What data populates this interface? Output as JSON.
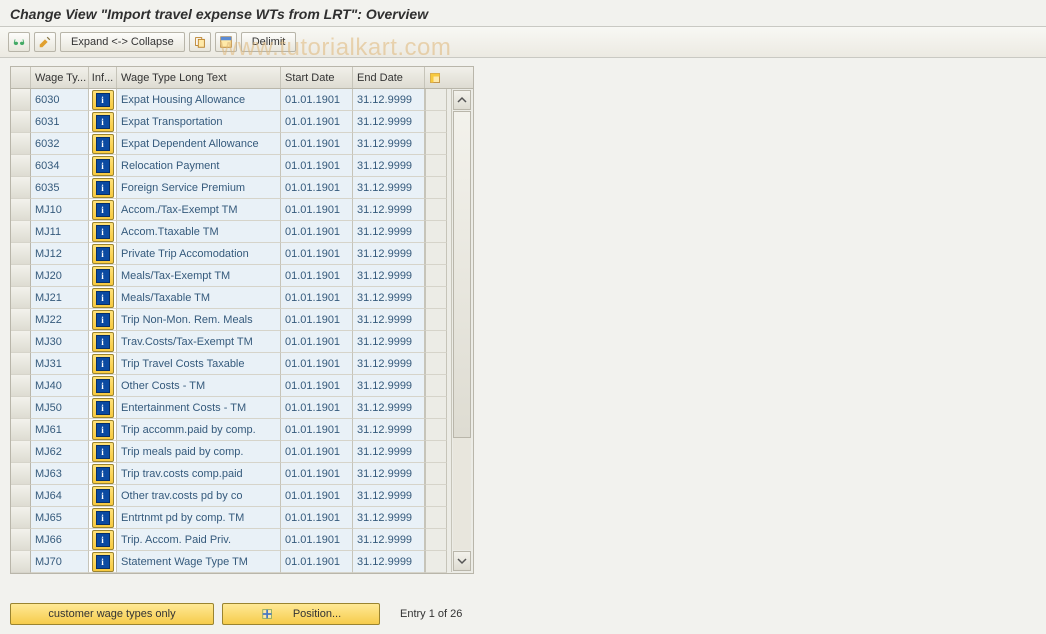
{
  "title": "Change View \"Import travel expense WTs from LRT\": Overview",
  "watermark": "www.tutorialkart.com",
  "toolbar": {
    "expand_collapse": "Expand <-> Collapse",
    "delimit": "Delimit"
  },
  "grid": {
    "headers": {
      "wt": "Wage Ty...",
      "info": "Inf...",
      "longtext": "Wage Type Long Text",
      "start": "Start Date",
      "end": "End Date"
    },
    "rows": [
      {
        "wt": "6030",
        "lt": "Expat Housing Allowance",
        "sd": "01.01.1901",
        "ed": "31.12.9999"
      },
      {
        "wt": "6031",
        "lt": "Expat Transportation",
        "sd": "01.01.1901",
        "ed": "31.12.9999"
      },
      {
        "wt": "6032",
        "lt": "Expat Dependent Allowance",
        "sd": "01.01.1901",
        "ed": "31.12.9999"
      },
      {
        "wt": "6034",
        "lt": "Relocation Payment",
        "sd": "01.01.1901",
        "ed": "31.12.9999"
      },
      {
        "wt": "6035",
        "lt": "Foreign Service Premium",
        "sd": "01.01.1901",
        "ed": "31.12.9999"
      },
      {
        "wt": "MJ10",
        "lt": "Accom./Tax-Exempt TM",
        "sd": "01.01.1901",
        "ed": "31.12.9999"
      },
      {
        "wt": "MJ11",
        "lt": "Accom.Ttaxable TM",
        "sd": "01.01.1901",
        "ed": "31.12.9999"
      },
      {
        "wt": "MJ12",
        "lt": "Private Trip Accomodation",
        "sd": "01.01.1901",
        "ed": "31.12.9999"
      },
      {
        "wt": "MJ20",
        "lt": "Meals/Tax-Exempt TM",
        "sd": "01.01.1901",
        "ed": "31.12.9999"
      },
      {
        "wt": "MJ21",
        "lt": "Meals/Taxable TM",
        "sd": "01.01.1901",
        "ed": "31.12.9999"
      },
      {
        "wt": "MJ22",
        "lt": "Trip Non-Mon. Rem. Meals",
        "sd": "01.01.1901",
        "ed": "31.12.9999"
      },
      {
        "wt": "MJ30",
        "lt": "Trav.Costs/Tax-Exempt TM",
        "sd": "01.01.1901",
        "ed": "31.12.9999"
      },
      {
        "wt": "MJ31",
        "lt": "Trip Travel Costs Taxable",
        "sd": "01.01.1901",
        "ed": "31.12.9999"
      },
      {
        "wt": "MJ40",
        "lt": "Other Costs - TM",
        "sd": "01.01.1901",
        "ed": "31.12.9999"
      },
      {
        "wt": "MJ50",
        "lt": "Entertainment Costs - TM",
        "sd": "01.01.1901",
        "ed": "31.12.9999"
      },
      {
        "wt": "MJ61",
        "lt": "Trip accomm.paid by comp.",
        "sd": "01.01.1901",
        "ed": "31.12.9999"
      },
      {
        "wt": "MJ62",
        "lt": "Trip meals paid by comp.",
        "sd": "01.01.1901",
        "ed": "31.12.9999"
      },
      {
        "wt": "MJ63",
        "lt": "Trip trav.costs comp.paid",
        "sd": "01.01.1901",
        "ed": "31.12.9999"
      },
      {
        "wt": "MJ64",
        "lt": "Other trav.costs pd by co",
        "sd": "01.01.1901",
        "ed": "31.12.9999"
      },
      {
        "wt": "MJ65",
        "lt": "Entrtnmt pd by comp. TM",
        "sd": "01.01.1901",
        "ed": "31.12.9999"
      },
      {
        "wt": "MJ66",
        "lt": "Trip. Accom. Paid Priv.",
        "sd": "01.01.1901",
        "ed": "31.12.9999"
      },
      {
        "wt": "MJ70",
        "lt": "Statement Wage Type  TM",
        "sd": "01.01.1901",
        "ed": "31.12.9999"
      }
    ]
  },
  "footer": {
    "customer_only": "customer wage types only",
    "position": "Position...",
    "status": "Entry 1 of 26"
  }
}
